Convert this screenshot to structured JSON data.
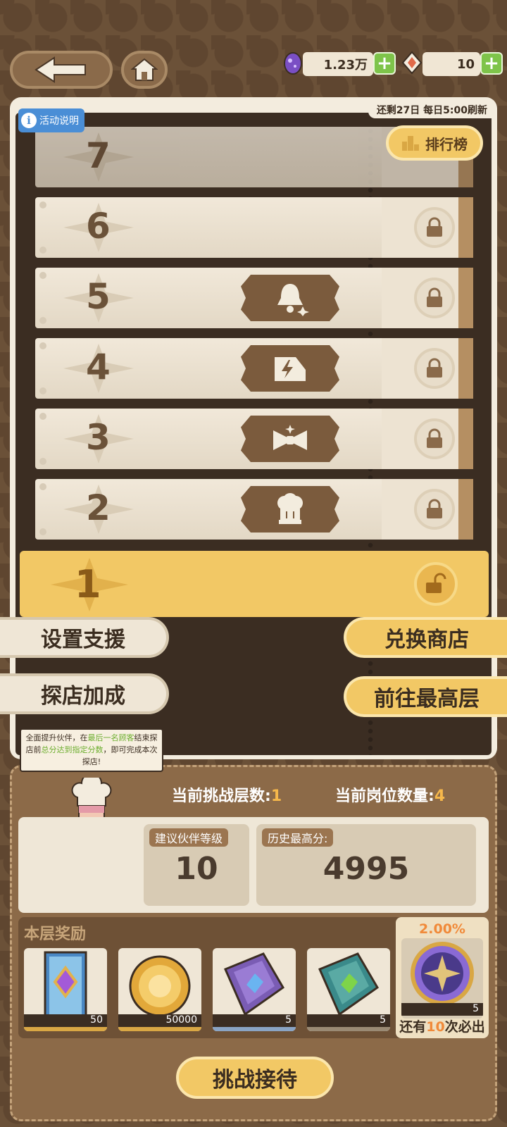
{
  "top": {
    "back_icon": "arrow-left-icon",
    "home_icon": "home-icon",
    "gems": "1.23万",
    "tickets": "10"
  },
  "panel": {
    "timer": "还剩27日 每日5:00刷新",
    "info_label": "活动说明",
    "ranking_label": "排行榜"
  },
  "floors": {
    "f7": "7",
    "f6": "6",
    "f5": "5",
    "f4": "4",
    "f3": "3",
    "f2": "2",
    "f1": "1"
  },
  "side_buttons": {
    "support": "设置支援",
    "shop": "兑换商店",
    "bonus": "探店加成",
    "highest": "前往最高层"
  },
  "tip": {
    "p1": "全面提升伙伴，在",
    "h1": "最后一名顾客",
    "p2": "结束探店前",
    "h2": "总分达到指定分数",
    "p3": "，即可完成本次探店!"
  },
  "stats": {
    "floor_label": "当前挑战层数:",
    "floor_value": "1",
    "slots_label": "当前岗位数量:",
    "slots_value": "4",
    "rec_level_label": "建议伙伴等级",
    "rec_level_value": "10",
    "best_label": "历史最高分:",
    "best_value": "4995"
  },
  "rewards": {
    "title": "本层奖励",
    "items": [
      {
        "count": "50"
      },
      {
        "count": "50000"
      },
      {
        "count": "5"
      },
      {
        "count": "5"
      }
    ],
    "special": {
      "pct": "2.00%",
      "count": "5",
      "guar_pre": "还有",
      "guar_n": "10",
      "guar_post": "次必出"
    }
  },
  "challenge_label": "挑战接待",
  "colors": {
    "gold": "#f2c865",
    "brown": "#6b5138",
    "cream": "#efe6d6",
    "accent_orange": "#f08a3a",
    "accent_green": "#7ec44a"
  }
}
